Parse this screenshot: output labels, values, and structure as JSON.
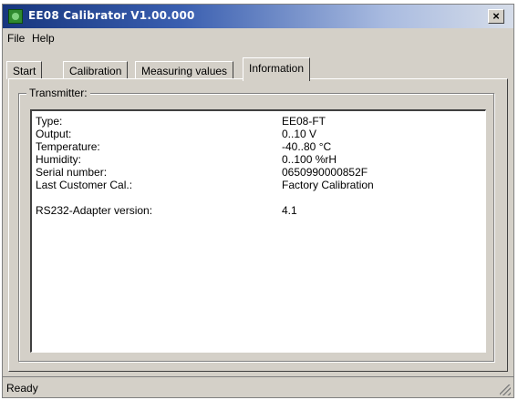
{
  "window": {
    "title": "EE08 Calibrator V1.00.000",
    "close_label": "×"
  },
  "menu": {
    "items": [
      "File",
      "Help"
    ]
  },
  "tabs": [
    {
      "label": "Start",
      "active": false
    },
    {
      "label": "Calibration",
      "active": false
    },
    {
      "label": "Measuring values",
      "active": false
    },
    {
      "label": "Information",
      "active": true
    }
  ],
  "transmitter": {
    "group_label": "Transmitter:",
    "rows": [
      {
        "label": "Type:",
        "value": "EE08-FT"
      },
      {
        "label": "Output:",
        "value": "0..10 V"
      },
      {
        "label": "Temperature:",
        "value": "-40..80 °C"
      },
      {
        "label": "Humidity:",
        "value": "0..100 %rH"
      },
      {
        "label": "Serial number:",
        "value": "0650990000852F"
      },
      {
        "label": "Last Customer Cal.:",
        "value": "Factory Calibration"
      },
      {
        "label": "RS232-Adapter version:",
        "value": "4.1"
      }
    ]
  },
  "status": {
    "text": "Ready"
  },
  "icons": {
    "app": "calibrator-app-icon",
    "close": "close-icon",
    "grip": "resize-grip-icon"
  }
}
